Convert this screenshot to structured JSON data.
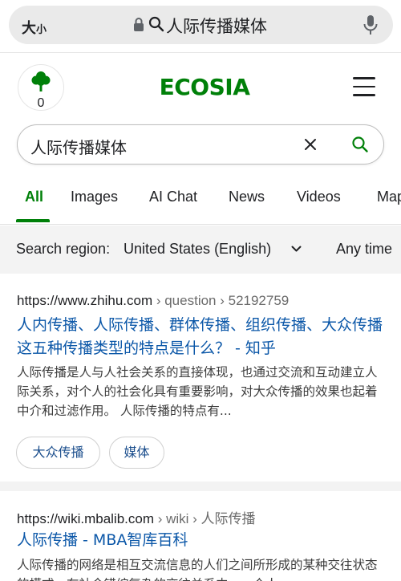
{
  "browser": {
    "text_size": "大",
    "text_size_small": "小",
    "address": "人际传播媒体"
  },
  "header": {
    "tree_count": "0",
    "logo": "ECOSIA"
  },
  "search": {
    "query": "人际传播媒体"
  },
  "tabs": [
    {
      "label": "All"
    },
    {
      "label": "Images"
    },
    {
      "label": "AI Chat"
    },
    {
      "label": "News"
    },
    {
      "label": "Videos"
    },
    {
      "label": "Maps"
    }
  ],
  "filters": {
    "region_label": "Search region:",
    "region_value": "United States (English)",
    "time": "Any time"
  },
  "results": [
    {
      "domain": "https://www.zhihu.com",
      "path": " › question › 52192759",
      "title": "人内传播、人际传播、群体传播、组织传播、大众传播这五种传播类型的特点是什么？ - 知乎",
      "snippet": "人际传播是人与人社会关系的直接体现，也通过交流和互动建立人际关系，对个人的社会化具有重要影响，对大众传播的效果也起着中介和过滤作用。 人际传播的特点有...",
      "chips": [
        "大众传播",
        "媒体"
      ]
    },
    {
      "domain": "https://wiki.mbalib.com",
      "path": " › wiki › 人际传播",
      "title": "人际传播 - MBA智库百科",
      "snippet": "人际传播的网络是相互交流信息的人们之间所形成的某种交往状态的模式。在社会错综复杂的交往关系中，一个人"
    }
  ],
  "colors": {
    "brand_green": "#008009",
    "link_blue": "#0b57a8"
  }
}
